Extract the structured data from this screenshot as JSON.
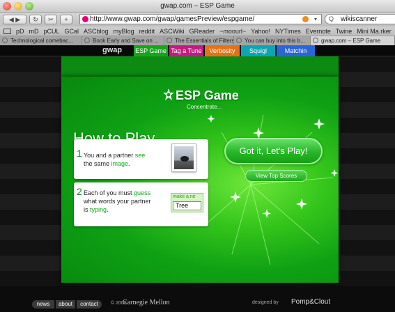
{
  "window": {
    "title": "gwap.com – ESP Game"
  },
  "toolbar": {
    "url": "http://www.gwap.com/gwap/gamesPreview/espgame/",
    "search_value": "wikiscanner",
    "search_icon": "Q"
  },
  "bookmarks": [
    "pD",
    "mD",
    "pCUL",
    "GCal",
    "ASCblog",
    "myBlog",
    "reddit",
    "ASCWiki",
    "GReader",
    "~moourl~",
    "Yahoo!",
    "NYTimes",
    "Evernote",
    "Twine",
    "Mini Ma.rker"
  ],
  "tabs": [
    "Technological comebac...",
    "Book Early and Save on ...",
    "The Essentials of Filters",
    "You can buy into this b...",
    "gwap.com – ESP Game"
  ],
  "site_nav": {
    "logo": "gwap",
    "items": [
      {
        "label": "ESP Game",
        "color": "#18a51d"
      },
      {
        "label": "Tag a Tune",
        "color": "#c01d82"
      },
      {
        "label": "Verbosity",
        "color": "#e3731a"
      },
      {
        "label": "Squigl",
        "color": "#0da5b3"
      },
      {
        "label": "Matchin",
        "color": "#2b66d6"
      }
    ]
  },
  "game": {
    "title": "ESP Game",
    "subtitle": "Concentrate...",
    "heading": "How to Play",
    "step1": {
      "num": "1",
      "text_a": "You and a partner ",
      "hl_a": "see",
      "text_b": "the same ",
      "hl_b": "image",
      "text_c": "."
    },
    "step2": {
      "num": "2",
      "text_a": "Each of you must ",
      "hl_a": "guess",
      "text_b": "what words your partner",
      "text_c": "is ",
      "hl_b": "typing",
      "text_d": "."
    },
    "guess_label": "make a ne",
    "guess_value": "Tree",
    "play_button": "Got it, Let's Play!",
    "scores_button": "View Top Scores"
  },
  "footer": {
    "links": [
      "news",
      "about",
      "contact"
    ],
    "copyright": "© 2008",
    "cmu": "Carnegie Mellon",
    "designed_by": "designed by",
    "designer": "Pomp&Clout"
  }
}
